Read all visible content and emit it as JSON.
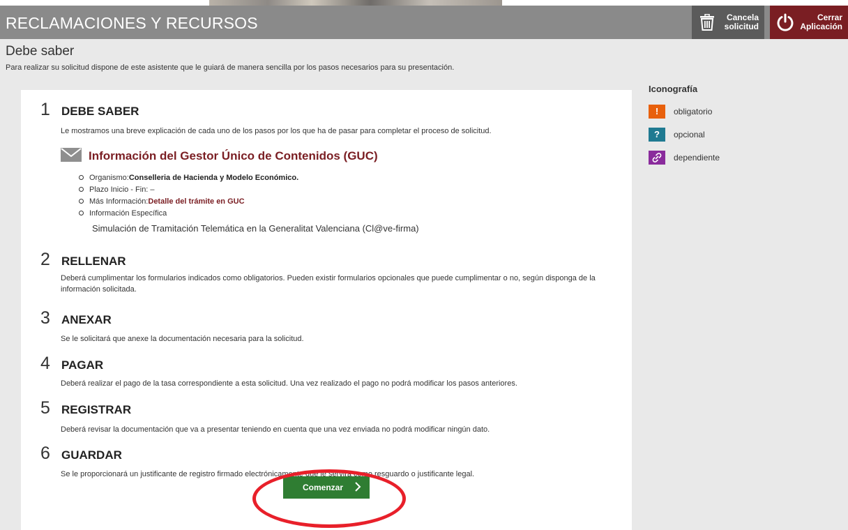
{
  "header": {
    "title": "RECLAMACIONES Y RECURSOS",
    "cancel_label_1": "Cancela",
    "cancel_label_2": "solicitud",
    "close_label_1": "Cerrar",
    "close_label_2": "Aplicación",
    "cancel_icon": "trash-icon",
    "close_icon": "power-icon"
  },
  "page": {
    "title": "Debe saber",
    "subtitle": "Para realizar su solicitud dispone de este asistente que le guiará de manera sencilla por los pasos necesarios para su presentación."
  },
  "steps": [
    {
      "num": "1",
      "title": "DEBE SABER",
      "desc": "Le mostramos una breve explicación de cada uno de los pasos por los que ha de pasar para completar el proceso de solicitud."
    },
    {
      "num": "2",
      "title": "RELLENAR",
      "desc": "Deberá cumplimentar los formularios indicados como obligatorios. Pueden existir formularios opcionales que puede cumplimentar o no, según disponga de la información solicitada."
    },
    {
      "num": "3",
      "title": "ANEXAR",
      "desc": "Se le solicitará que anexe la documentación necesaria para la solicitud."
    },
    {
      "num": "4",
      "title": "PAGAR",
      "desc": "Deberá realizar el pago de la tasa correspondiente a esta solicitud. Una vez realizado el pago no podrá modificar los pasos anteriores."
    },
    {
      "num": "5",
      "title": "REGISTRAR",
      "desc": "Deberá revisar la documentación que va a presentar teniendo en cuenta que una vez enviada no podrá modificar ningún dato."
    },
    {
      "num": "6",
      "title": "GUARDAR",
      "desc": "Se le proporcionará un justificante de registro firmado electrónicamente que le servirá como resguardo o justificante legal."
    }
  ],
  "guc": {
    "title": "Información del Gestor Único de Contenidos (GUC)",
    "organismo_label": "Organismo:",
    "organismo_value": "Conselleria de Hacienda y Modelo Económico.",
    "plazo_label": "Plazo Inicio - Fin: –",
    "mas_info_label": "Más Información:",
    "mas_info_link": "Detalle del trámite en GUC",
    "info_especifica_label": "Información Específica",
    "info_especifica_text": "Simulación de Tramitación Telemática en la Generalitat Valenciana (Cl@ve-firma)"
  },
  "start_button": {
    "label": "Comenzar",
    "icon": "chevron-right-icon"
  },
  "legend": {
    "title": "Iconografía",
    "items": [
      {
        "symbol": "!",
        "label": "obligatorio",
        "color": "#e8600c"
      },
      {
        "symbol": "?",
        "label": "opcional",
        "color": "#1f7a91"
      },
      {
        "symbol": "link",
        "label": "dependiente",
        "color": "#8a2b9c"
      }
    ]
  },
  "colors": {
    "header_bg": "#8a8a8a",
    "close_bg": "#7a1e23",
    "cancel_bg": "#5b5b5b",
    "start_bg": "#2f7d32",
    "highlight": "#e8202a"
  }
}
